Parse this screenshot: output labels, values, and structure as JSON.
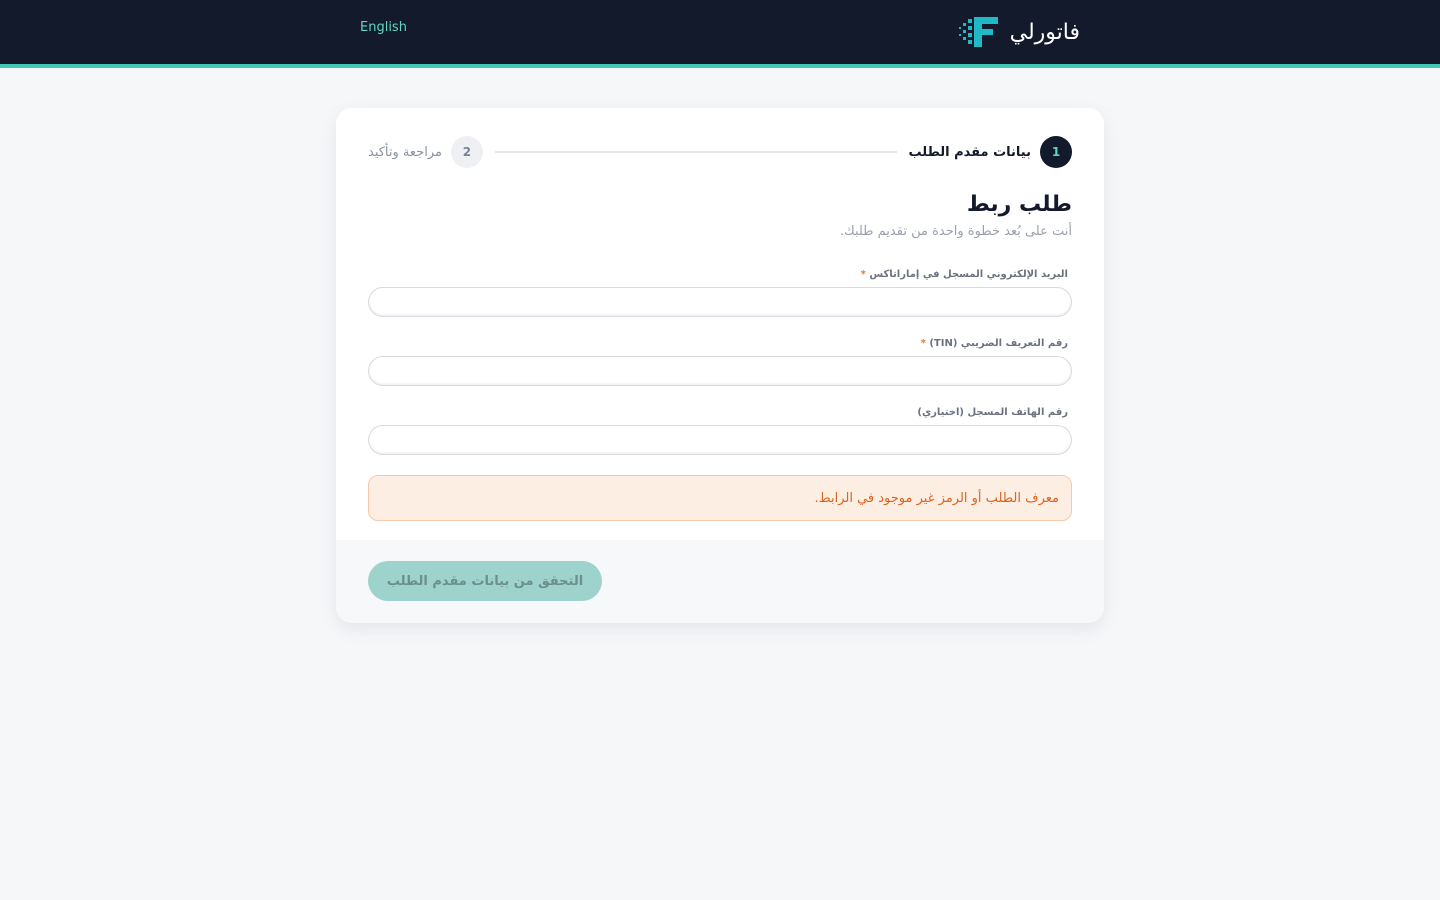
{
  "header": {
    "language_link": "English",
    "brand_name": "فاتورلي",
    "colors": {
      "bar": "#121a2b",
      "accent": "#3fc9b6"
    },
    "logo_icon": "f-pixel-logo"
  },
  "stepper": {
    "steps": [
      {
        "number": "1",
        "label": "بيانات مقدم الطلب",
        "state": "active"
      },
      {
        "number": "2",
        "label": "مراجعة وتأكيد",
        "state": "inactive"
      }
    ]
  },
  "form": {
    "title": "طلب ربط",
    "subtitle": "أنت على بُعد خطوة واحدة من تقديم طلبك.",
    "fields": [
      {
        "label": "البريد الإلكتروني المسجل في إماراتاكس",
        "required": "*",
        "value": ""
      },
      {
        "label": "رقم التعريف الضريبي (TIN)",
        "required": "*",
        "value": ""
      },
      {
        "label": "رقم الهاتف المسجل (اختياري)",
        "value": ""
      }
    ],
    "alert": "معرف الطلب أو الرمز غير موجود في الرابط.",
    "submit_label": "التحقق من بيانات مقدم الطلب"
  }
}
